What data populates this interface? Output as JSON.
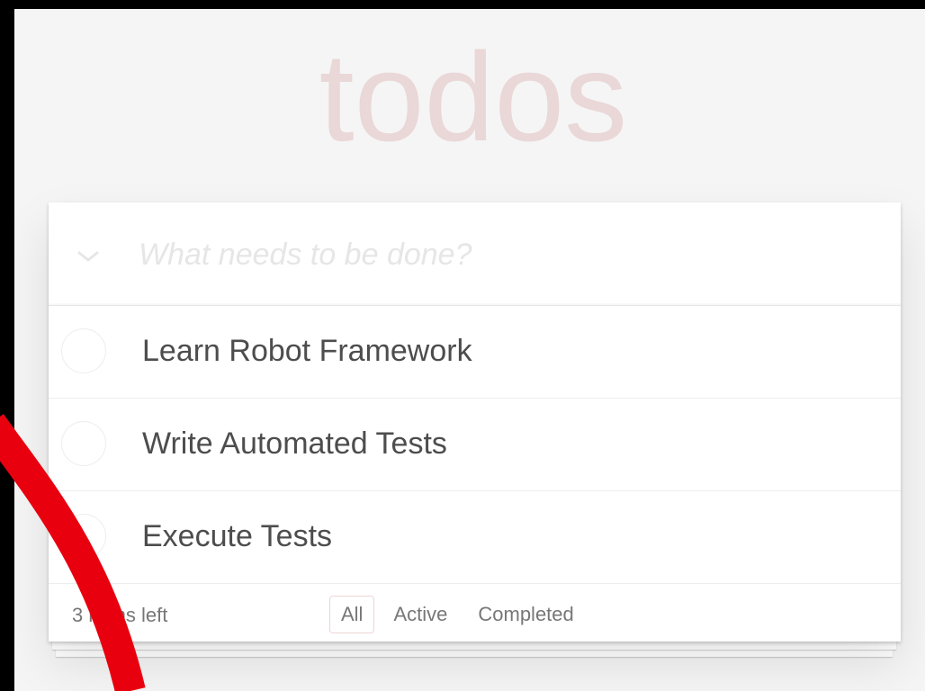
{
  "app": {
    "title": "todos"
  },
  "new_todo": {
    "placeholder": "What needs to be done?",
    "value": ""
  },
  "toggle_all": {
    "icon": "chevron-down-icon"
  },
  "todos": [
    {
      "label": "Learn Robot Framework",
      "completed": false
    },
    {
      "label": "Write Automated Tests",
      "completed": false
    },
    {
      "label": "Execute Tests",
      "completed": false
    }
  ],
  "footer": {
    "count_text": "3 items left",
    "filters": [
      {
        "label": "All",
        "selected": true
      },
      {
        "label": "Active",
        "selected": false
      },
      {
        "label": "Completed",
        "selected": false
      }
    ]
  },
  "colors": {
    "title": "#af2f2f",
    "background": "#f5f5f5",
    "text": "#4d4d4d",
    "annotation": "#e8000f"
  }
}
